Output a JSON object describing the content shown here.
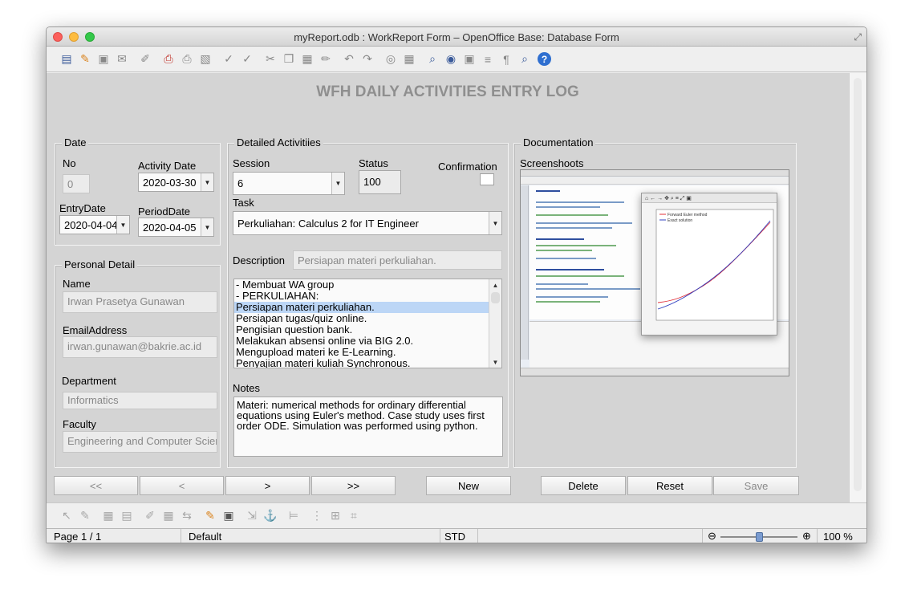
{
  "window": {
    "title": "myReport.odb : WorkReport Form – OpenOffice Base: Database Form"
  },
  "toolbar": {
    "icons": [
      "edit-document-icon",
      "new-document-icon",
      "save-icon",
      "send-email-icon",
      "edit-mode-icon",
      "export-pdf-icon",
      "print-icon",
      "print-preview-icon",
      "spellcheck-icon",
      "autospellcheck-icon",
      "cut-icon",
      "copy-icon",
      "paste-icon",
      "clone-formatting-icon",
      "undo-icon",
      "redo-icon",
      "navigator-icon",
      "table-icon",
      "find-icon",
      "hyperlink-icon",
      "gallery-icon",
      "data-sources-icon",
      "formatting-marks-icon",
      "zoom-icon",
      "help-icon"
    ]
  },
  "form": {
    "title": "WFH DAILY ACTIVITIES ENTRY LOG",
    "date_group": {
      "legend": "Date",
      "no_label": "No",
      "no_value": "0",
      "activity_date_label": "Activity Date",
      "activity_date_value": "2020-03-30",
      "entry_date_label": "EntryDate",
      "entry_date_value": "2020-04-04",
      "period_date_label": "PeriodDate",
      "period_date_value": "2020-04-05"
    },
    "personal_group": {
      "legend": "Personal Detail",
      "name_label": "Name",
      "name_value": "Irwan Prasetya Gunawan",
      "email_label": "EmailAddress",
      "email_value": "irwan.gunawan@bakrie.ac.id",
      "department_label": "Department",
      "department_value": "Informatics",
      "faculty_label": "Faculty",
      "faculty_value": "Engineering and Computer Scier"
    },
    "activities_group": {
      "legend": "Detailed Activitiies",
      "session_label": "Session",
      "session_value": "6",
      "status_label": "Status",
      "status_value": "100",
      "confirmation_label": "Confirmation",
      "task_label": "Task",
      "task_value": "Perkuliahan: Calculus 2 for IT Engineer",
      "description_label": "Description",
      "description_value": "Persiapan materi perkuliahan.",
      "list_items": [
        "- Membuat WA group",
        "- PERKULIAHAN:",
        "Persiapan materi perkuliahan.",
        "Persiapan tugas/quiz online.",
        "Pengisian question bank.",
        "Melakukan absensi online via BIG 2.0.",
        "Mengupload materi ke E-Learning.",
        "Penyajian materi kuliah Synchronous."
      ],
      "selected_index": 2,
      "notes_label": "Notes",
      "notes_lines": [
        "Materi: numerical methods for ordinary differential",
        "equations using Euler's method. Case study uses first",
        "order ODE. Simulation was performed using python."
      ]
    },
    "documentation_group": {
      "legend": "Documentation",
      "screenshots_label": "Screenshoots",
      "plot_legend": [
        "Forward Euler method",
        "Exact solution"
      ]
    },
    "nav": {
      "first": "<<",
      "prev": "<",
      "next": ">",
      "last": ">>",
      "new": "New",
      "delete": "Delete",
      "reset": "Reset",
      "save": "Save"
    }
  },
  "statusbar": {
    "page": "Page 1 / 1",
    "style": "Default",
    "mode": "STD",
    "zoom": "100 %"
  },
  "colors": {
    "selection": "#bcd6f6",
    "series_forward_euler": "#e0303a",
    "series_exact": "#3040c0",
    "help_blue": "#2f6fd0"
  }
}
